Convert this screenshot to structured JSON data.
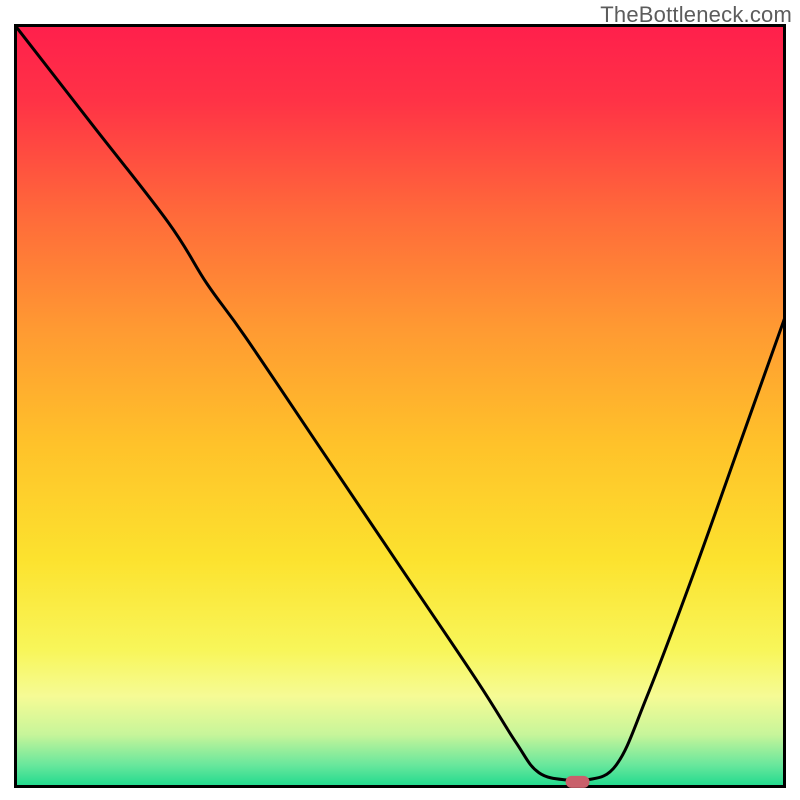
{
  "watermark": "TheBottleneck.com",
  "chart_data": {
    "type": "line",
    "title": "",
    "xlabel": "",
    "ylabel": "",
    "xlim": [
      0,
      100
    ],
    "ylim": [
      0,
      100
    ],
    "grid": false,
    "series": [
      {
        "name": "curve",
        "x": [
          0,
          10,
          20,
          25,
          30,
          40,
          50,
          60,
          65,
          68,
          72,
          74,
          78,
          82,
          88,
          94,
          100
        ],
        "values": [
          100,
          87,
          74,
          66,
          59,
          44,
          29,
          14,
          6,
          2,
          1,
          1,
          3,
          12,
          28,
          45,
          62
        ]
      }
    ],
    "marker": {
      "x": 73,
      "y": 0.8,
      "color": "#c9606b"
    },
    "gradient_stops": [
      {
        "offset": 0.0,
        "color": "#ff1f4c"
      },
      {
        "offset": 0.1,
        "color": "#ff3246"
      },
      {
        "offset": 0.25,
        "color": "#ff6a3a"
      },
      {
        "offset": 0.4,
        "color": "#ff9a32"
      },
      {
        "offset": 0.55,
        "color": "#ffc22a"
      },
      {
        "offset": 0.7,
        "color": "#fce22e"
      },
      {
        "offset": 0.82,
        "color": "#f8f65a"
      },
      {
        "offset": 0.88,
        "color": "#f6fb95"
      },
      {
        "offset": 0.93,
        "color": "#c7f59a"
      },
      {
        "offset": 0.97,
        "color": "#68e79c"
      },
      {
        "offset": 1.0,
        "color": "#1ad98d"
      }
    ],
    "axis_color": "#000000",
    "line_color": "#000000",
    "line_width": 3
  }
}
